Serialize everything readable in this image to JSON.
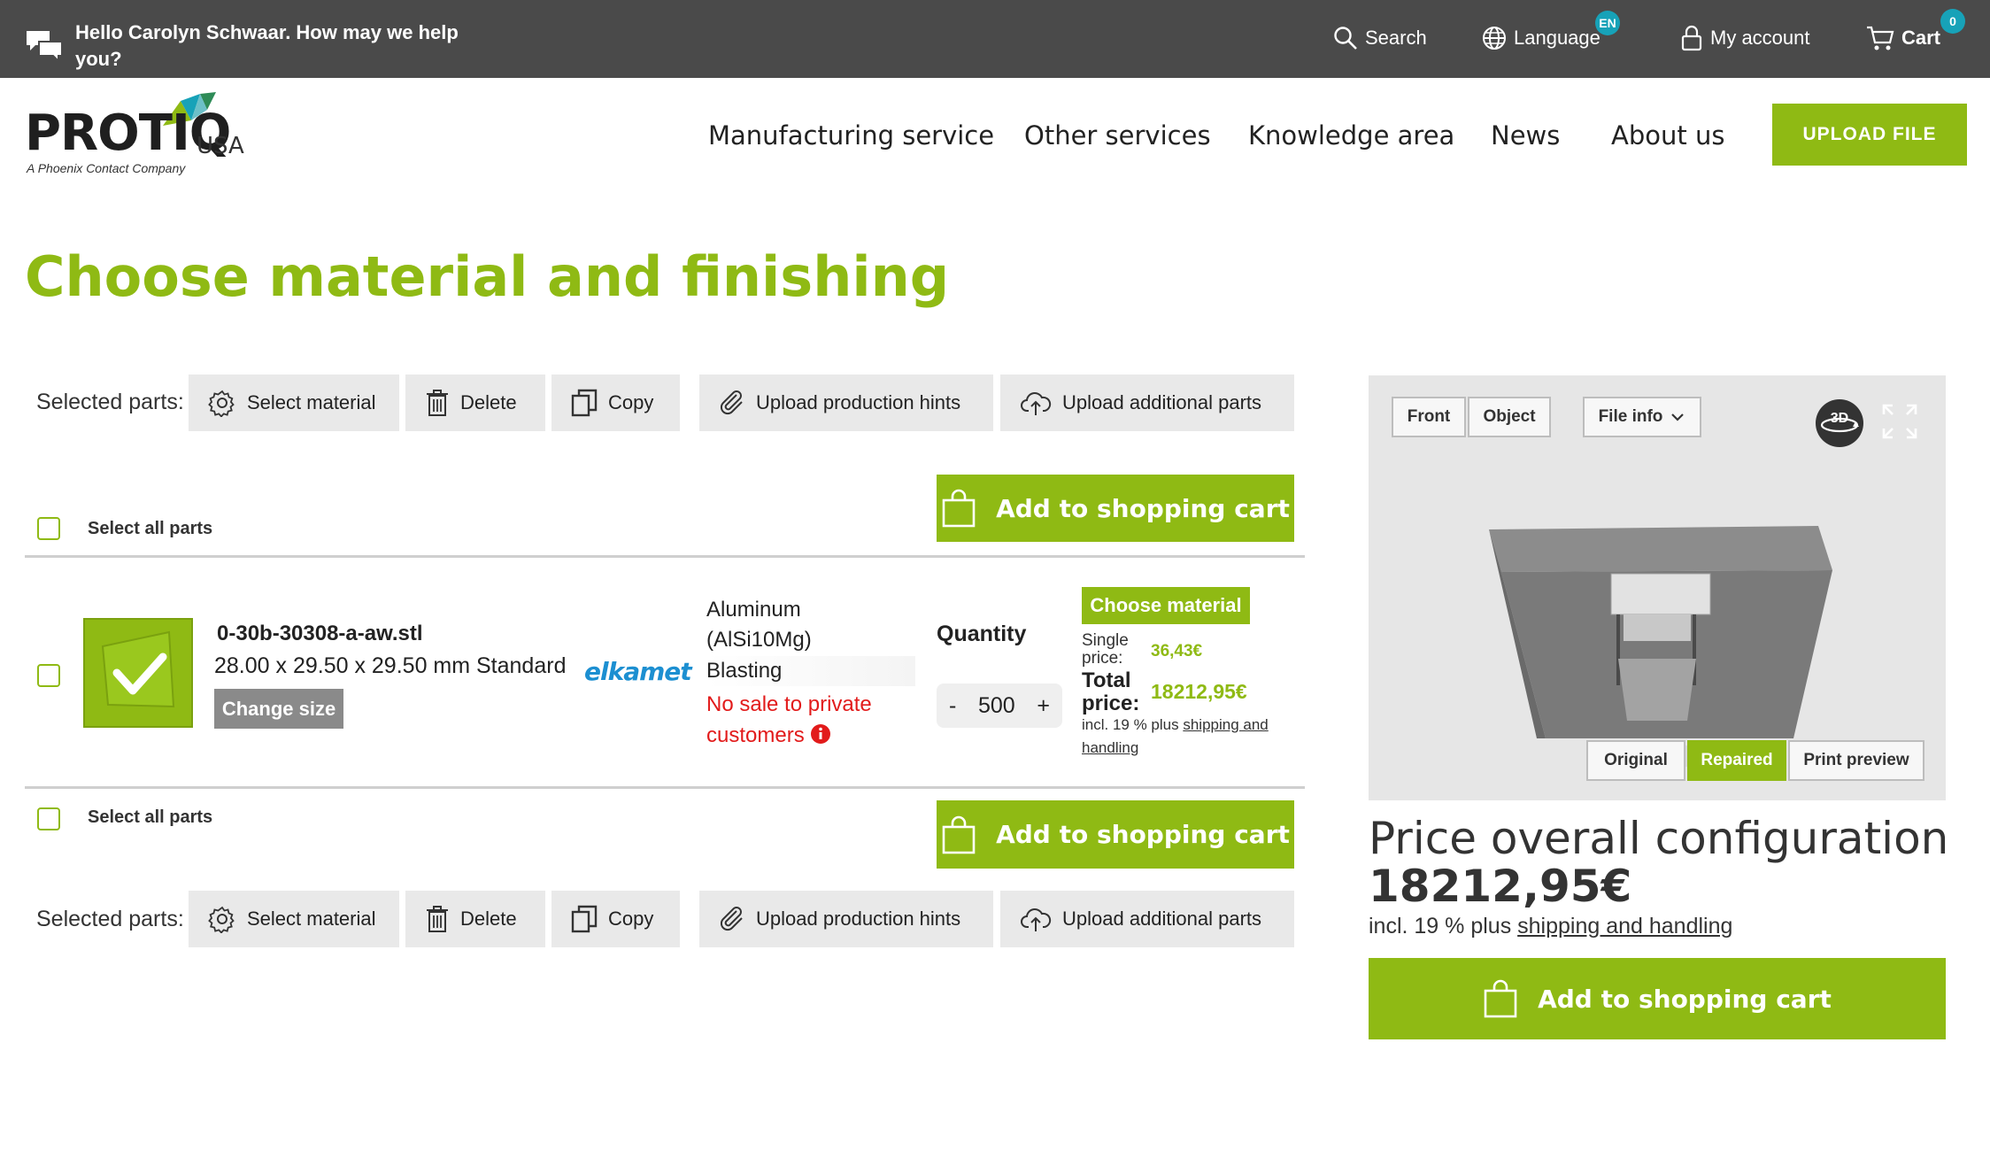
{
  "topbar": {
    "greeting": "Hello Carolyn Schwaar. How may we help you?",
    "search": "Search",
    "language": "Language",
    "language_badge": "EN",
    "account": "My account",
    "cart": "Cart",
    "cart_count": "0"
  },
  "header": {
    "logo": "PROTIQ",
    "logo_suffix": "USA",
    "logo_tagline": "A Phoenix Contact Company",
    "nav": [
      "Manufacturing service",
      "Other services",
      "Knowledge area",
      "News",
      "About us"
    ],
    "upload_button": "UPLOAD FILE"
  },
  "page_title": "Choose material and finishing",
  "toolbar": {
    "label": "Selected parts:",
    "select_material": "Select material",
    "delete": "Delete",
    "copy": "Copy",
    "upload_hints": "Upload production hints",
    "upload_parts": "Upload additional parts"
  },
  "select_all": "Select all parts",
  "add_to_cart": "Add to shopping cart",
  "part": {
    "filename": "0-30b-30308-a-aw.stl",
    "dimensions": "28.00 x 29.50 x 29.50 mm Standard",
    "change_size": "Change size",
    "supplier": "elkamet",
    "material_line1": "Aluminum",
    "material_line2": "(AlSi10Mg)",
    "finishing": "Blasting",
    "no_sale": "No sale to private customers",
    "quantity_label": "Quantity",
    "quantity_minus": "-",
    "quantity": "500",
    "quantity_plus": "+",
    "choose_material": "Choose material",
    "single_price_label": "Single price:",
    "single_price": "36,43€",
    "total_price_label": "Total price:",
    "total_price": "18212,95€",
    "price_note_prefix": "incl. 19 % plus ",
    "price_note_link": "shipping and handling"
  },
  "viewer": {
    "front": "Front",
    "object": "Object",
    "file_info": "File info",
    "badge_3d": "3D",
    "original": "Original",
    "repaired": "Repaired",
    "print_preview": "Print preview"
  },
  "overall": {
    "title": "Price overall configuration",
    "price": "18212,95€",
    "note_prefix": "incl. 19 % plus ",
    "note_link": "shipping and handling",
    "add_to_cart": "Add to shopping cart"
  },
  "colors": {
    "brand_green": "#8fba14",
    "topbar": "#4a4a4a",
    "badge": "#17a2b8",
    "alert_red": "#e21b1b"
  }
}
